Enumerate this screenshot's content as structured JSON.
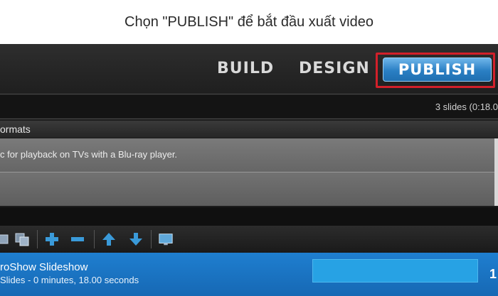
{
  "caption": "Chọn \"PUBLISH\" để bắt đầu xuất video",
  "nav": {
    "build": "BUILD",
    "design": "DESIGN",
    "publish": "PUBLISH"
  },
  "status": {
    "slide_count": "3 slides (0:18.0"
  },
  "formats": {
    "title": "ormats",
    "items": [
      {
        "description": "c for playback on TVs with a Blu-ray player."
      },
      {
        "description": ""
      }
    ]
  },
  "toolbar": {
    "icons": [
      "slides-icon",
      "copy-icon",
      "add-icon",
      "remove-icon",
      "move-up-icon",
      "move-down-icon",
      "monitor-icon"
    ]
  },
  "slideshow": {
    "title": "roShow Slideshow",
    "info": "Slides - 0 minutes, 18.00 seconds",
    "edge_char": "1"
  },
  "colors": {
    "publish_highlight": "#d2202a",
    "publish_button": "#2a7fc4",
    "selected_row": "#1f7fd0"
  }
}
